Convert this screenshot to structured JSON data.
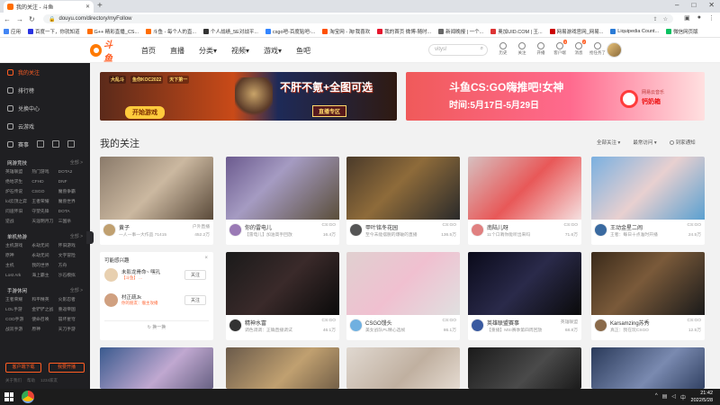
{
  "browser": {
    "tab_title": "我的关注 - 斗鱼",
    "url": "douyu.com/directory/myFollow",
    "bookmarks": [
      {
        "label": "应用",
        "color": "#4285f4"
      },
      {
        "label": "百度一下，你就知道",
        "color": "#2932e1"
      },
      {
        "label": "G++ 精彩直播_CS...",
        "color": "#ff6d00"
      },
      {
        "label": "斗鱼 - 每个人的直...",
        "color": "#ff6d00"
      },
      {
        "label": "个人战绩_5E对战平...",
        "color": "#333333"
      },
      {
        "label": "csgo吧-百度贴吧-...",
        "color": "#3385ff"
      },
      {
        "label": "淘宝网 - 淘!我喜欢",
        "color": "#ff5000"
      },
      {
        "label": "我的首页 微博-随时...",
        "color": "#e6162d"
      },
      {
        "label": "新闻晚报 | 一个... ",
        "color": "#666666"
      },
      {
        "label": "奥加UID.COM | 王...",
        "color": "#d33"
      },
      {
        "label": "网易游戏官网_网易...",
        "color": "#c00"
      },
      {
        "label": "Liquipedia Count...",
        "color": "#2b7bd6"
      },
      {
        "label": "微信网页版",
        "color": "#07c160"
      }
    ]
  },
  "header": {
    "logo_text": "斗鱼",
    "nav": [
      "首页",
      "直播",
      "分类",
      "视频",
      "游戏",
      "鱼吧"
    ],
    "search_placeholder": "vitys!",
    "tools": [
      {
        "label": "历史",
        "badge": ""
      },
      {
        "label": "关注",
        "badge": ""
      },
      {
        "label": "开播",
        "badge": ""
      },
      {
        "label": "客户端",
        "badge": "3"
      },
      {
        "label": "消息",
        "badge": "2"
      },
      {
        "label": "抢任务了",
        "badge": ""
      }
    ]
  },
  "sidebar": {
    "items": [
      {
        "label": "我的关注",
        "active": true
      },
      {
        "label": "排行榜",
        "active": false
      },
      {
        "label": "兑换中心",
        "active": false
      },
      {
        "label": "云游戏",
        "active": false
      },
      {
        "label": "赛事",
        "active": false
      }
    ],
    "sections": [
      {
        "title": "网游竞技",
        "all": "全部 >",
        "items": [
          "英雄联盟",
          "热门游戏",
          "DOTA2",
          "绝地求生",
          "CFHD",
          "DNF",
          "炉石传说",
          "CSGO",
          "魔兽争霸",
          "lol云顶之弈",
          "王者荣耀",
          "魔兽世界",
          "问道怀旧",
          "守望先锋",
          "DOTA",
          "逆战",
          "天涯明月刀",
          "三国杀"
        ]
      },
      {
        "title": "单机热游",
        "all": "全部 >",
        "items": [
          "主机游戏",
          "永劫无间",
          "怀旧游戏",
          "原神",
          "永劫无间",
          "文字冒险",
          "主机",
          "我的世界",
          "方舟",
          "Lost Ark",
          "海上霸主",
          "沙石模拟"
        ]
      },
      {
        "title": "手游休闲",
        "all": "全部 >",
        "items": [
          "王者荣耀",
          "和平精英",
          "火影忍者",
          "LOL手游",
          "金铲铲之战",
          "重返帝国",
          "COD手游",
          "使命召唤",
          "崩坏星穹",
          "战双手游",
          "原神",
          "天刀手游"
        ]
      }
    ],
    "btn_download": "客户端下载",
    "btn_live": "我要开播",
    "footer": [
      "关于我们",
      "帮助",
      "1234家友"
    ]
  },
  "banners": {
    "left": {
      "tags": [
        "大乱斗",
        "鱼你KOC2022",
        "天下第一"
      ],
      "play": "开始游戏",
      "slogan": "不肝不氪+全图可选",
      "zone": "直播专区"
    },
    "right": {
      "slogan": "斗鱼CS:GO嗨推吧!女神",
      "dates": "时间:5月17日-5月29日",
      "logo_top": "网易云音乐",
      "logo_bottom": "钙奶箱"
    }
  },
  "main": {
    "title": "我的关注",
    "filter_all": "全部关注",
    "filter_sort": "最常访问",
    "remind": "到家通知"
  },
  "cards": [
    {
      "name": "黄子",
      "game": "户外直播",
      "sub": "一人一事一大作品 71415",
      "heat": "452.2万",
      "thumb": "linear-gradient(135deg,#8a7a6a,#cbb8a0 50%,#5a4a3a)",
      "av": "#c0a070"
    },
    {
      "name": "你的雷电儿",
      "game": "CS:GO",
      "sub": "【雷电儿】加油高手回放",
      "heat": "16.4万",
      "thumb": "linear-gradient(135deg,#6b5a8e,#a59bc2 40%,#5a4e3a)",
      "av": "#9a7ab5"
    },
    {
      "name": "甲叶铭冬花园",
      "game": "CS:GO",
      "sub": "至今未能摆脱的爆破的直播",
      "heat": "136.5万",
      "thumb": "linear-gradient(135deg,#4a3a2a,#8e6b3a 45%,#2a2a2a)",
      "av": "#555555"
    },
    {
      "name": "南陆儿呀",
      "game": "CS:GO",
      "sub": "11个口哨你能听出来吗",
      "heat": "71.6万",
      "thumb": "linear-gradient(135deg,#d6c0c0,#e85858 50%,#f5e0e0)",
      "av": "#e08080"
    },
    {
      "name": "王动金星二闹",
      "game": "CS:GO",
      "sub": "王者：每日十点准时开播",
      "heat": "24.5万",
      "thumb": "linear-gradient(135deg,#7ab0e0,#e8d0d0 50%,#5aa0d0)",
      "av": "#3a6aa0"
    },
    {
      "name": "精神水富",
      "game": "CS:GO",
      "sub": "调色调调：正确直播调试",
      "heat": "46.1万",
      "thumb": "linear-gradient(135deg,#1a1a1a,#3a2a2a 50%,#0a0a0a)",
      "av": "#333333"
    },
    {
      "name": "CSGO馒头",
      "game": "CS:GO",
      "sub": "美女战队PL精心选帧",
      "heat": "86.1万",
      "thumb": "linear-gradient(135deg,#e0d0d0,#f0c0d0 50%,#e0e0e0)",
      "av": "#70b0e0"
    },
    {
      "name": "英雄联盟赛事",
      "game": "英雄联盟",
      "sub": "【重播】MSI赛季第四周回放",
      "heat": "68.8万",
      "thumb": "linear-gradient(135deg,#0a0a1a,#2a2a4a 50%,#0a0a0a)",
      "av": "#3a5aa0"
    },
    {
      "name": "Karsamzing苏秀",
      "game": "CS:GO",
      "sub": "真正：我在玩CSGO",
      "heat": "12.5万",
      "thumb": "linear-gradient(135deg,#3a2a1a,#7a5a3a 45%,#1a1a1a)",
      "av": "#8a6a4a"
    },
    {
      "name": "",
      "game": "",
      "sub": "",
      "heat": "",
      "thumb": "linear-gradient(135deg,#3a5a8e,#c0a8d0 50%,#4a4a6a)",
      "av": ""
    },
    {
      "name": "",
      "game": "",
      "sub": "",
      "heat": "",
      "thumb": "linear-gradient(135deg,#6a5a4a,#c0a070 50%,#5a4a3a)",
      "av": ""
    },
    {
      "name": "",
      "game": "",
      "sub": "",
      "heat": "",
      "thumb": "linear-gradient(135deg,#e0d8d0,#c0b0a0 50%,#f0e8e0)",
      "av": ""
    },
    {
      "name": "",
      "game": "",
      "sub": "",
      "heat": "",
      "thumb": "linear-gradient(135deg,#1a1a1a,#4a4a4a 50%,#0a0a0a)",
      "av": ""
    },
    {
      "name": "",
      "game": "",
      "sub": "",
      "heat": "",
      "thumb": "linear-gradient(135deg,#2a3a5a,#7a8ab0 50%,#1a2a4a)",
      "av": ""
    }
  ],
  "recommend": {
    "title": "可能感兴趣",
    "close": "×",
    "items": [
      {
        "name": "未影龙骨命~ 嘿孔",
        "sub": "【斗鱼】 ... ",
        "follow": "关注",
        "av": "#e8d0b0"
      },
      {
        "name": "村正疏Jk",
        "sub": "你的朋友：瘤主攻播",
        "follow": "关注",
        "av": "#d0a080"
      }
    ],
    "change": "换一换"
  },
  "taskbar": {
    "time": "21:42",
    "date": "2022/5/28"
  }
}
